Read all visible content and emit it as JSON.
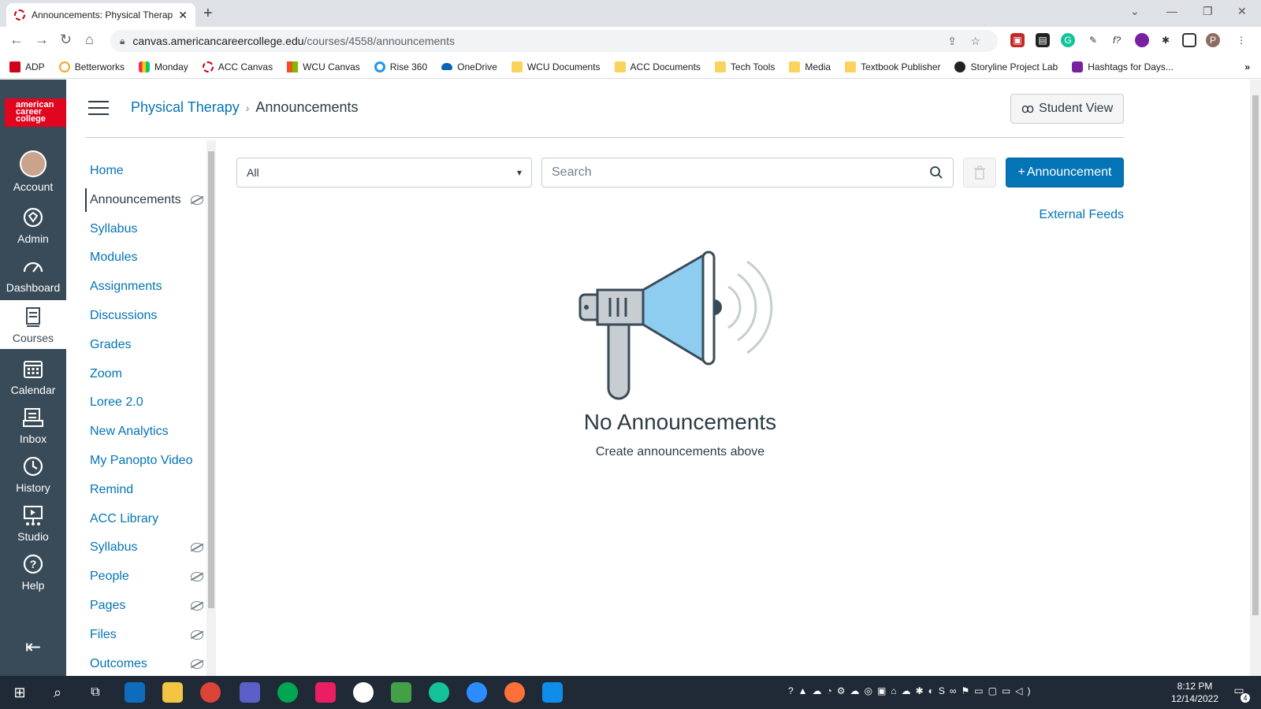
{
  "browser": {
    "tab_title": "Announcements: Physical Therap",
    "url_host": "canvas.americancareercollege.edu",
    "url_path": "/courses/4558/announcements",
    "bookmarks": [
      {
        "label": "ADP",
        "icon": "adp-icon"
      },
      {
        "label": "Betterworks",
        "icon": "betterworks-icon"
      },
      {
        "label": "Monday",
        "icon": "monday-icon"
      },
      {
        "label": "ACC Canvas",
        "icon": "canvas-icon"
      },
      {
        "label": "WCU Canvas",
        "icon": "windows-grid-icon"
      },
      {
        "label": "Rise 360",
        "icon": "rise-icon"
      },
      {
        "label": "OneDrive",
        "icon": "onedrive-icon"
      },
      {
        "label": "WCU Documents",
        "icon": "folder-icon"
      },
      {
        "label": "ACC Documents",
        "icon": "folder-icon"
      },
      {
        "label": "Tech Tools",
        "icon": "folder-icon"
      },
      {
        "label": "Media",
        "icon": "folder-icon"
      },
      {
        "label": "Textbook Publisher",
        "icon": "folder-icon"
      },
      {
        "label": "Storyline Project Lab",
        "icon": "storyline-icon"
      },
      {
        "label": "Hashtags for Days...",
        "icon": "lightbulb-icon"
      }
    ]
  },
  "global_nav": {
    "logo_text": "american career college",
    "items": [
      {
        "label": "Account",
        "icon": "avatar-icon"
      },
      {
        "label": "Admin",
        "icon": "shield-icon"
      },
      {
        "label": "Dashboard",
        "icon": "dashboard-icon"
      },
      {
        "label": "Courses",
        "icon": "book-icon"
      },
      {
        "label": "Calendar",
        "icon": "calendar-icon"
      },
      {
        "label": "Inbox",
        "icon": "inbox-icon"
      },
      {
        "label": "History",
        "icon": "clock-icon"
      },
      {
        "label": "Studio",
        "icon": "studio-icon"
      },
      {
        "label": "Help",
        "icon": "help-icon"
      }
    ]
  },
  "header": {
    "course_name": "Physical Therapy",
    "page_name": "Announcements",
    "student_view_label": "Student View"
  },
  "course_nav": [
    {
      "label": "Home",
      "hidden": false
    },
    {
      "label": "Announcements",
      "hidden": true
    },
    {
      "label": "Syllabus",
      "hidden": false
    },
    {
      "label": "Modules",
      "hidden": false
    },
    {
      "label": "Assignments",
      "hidden": false
    },
    {
      "label": "Discussions",
      "hidden": false
    },
    {
      "label": "Grades",
      "hidden": false
    },
    {
      "label": "Zoom",
      "hidden": false
    },
    {
      "label": "Loree 2.0",
      "hidden": false
    },
    {
      "label": "New Analytics",
      "hidden": false
    },
    {
      "label": "My Panopto Video",
      "hidden": false
    },
    {
      "label": "Remind",
      "hidden": false
    },
    {
      "label": "ACC Library",
      "hidden": false
    },
    {
      "label": "Syllabus",
      "hidden": true
    },
    {
      "label": "People",
      "hidden": true
    },
    {
      "label": "Pages",
      "hidden": true
    },
    {
      "label": "Files",
      "hidden": true
    },
    {
      "label": "Outcomes",
      "hidden": true
    }
  ],
  "main": {
    "filter_value": "All",
    "search_placeholder": "Search",
    "add_button_label": "Announcement",
    "external_feeds_label": "External Feeds",
    "empty_title": "No Announcements",
    "empty_subtitle": "Create announcements above"
  },
  "taskbar": {
    "time": "8:12 PM",
    "date": "12/14/2022",
    "notification_count": "4"
  },
  "colors": {
    "canvas_nav": "#394b58",
    "brand_blue": "#0374b5",
    "logo_red": "#e0061f"
  }
}
